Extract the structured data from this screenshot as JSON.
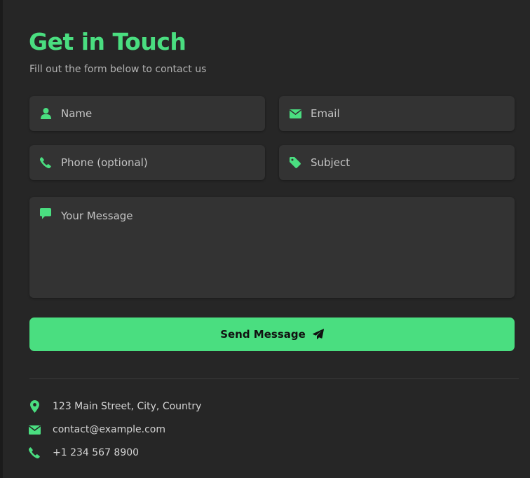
{
  "header": {
    "title": "Get in Touch",
    "subtitle": "Fill out the form below to contact us"
  },
  "form": {
    "name": {
      "placeholder": "Name",
      "value": "",
      "icon": "user-icon"
    },
    "email": {
      "placeholder": "Email",
      "value": "",
      "icon": "envelope-icon"
    },
    "phone": {
      "placeholder": "Phone (optional)",
      "value": "",
      "icon": "phone-icon"
    },
    "subject": {
      "placeholder": "Subject",
      "value": "",
      "icon": "tag-icon"
    },
    "message": {
      "placeholder": "Your Message",
      "value": "",
      "icon": "comment-icon"
    },
    "submit_label": "Send Message",
    "submit_icon": "paper-plane-icon"
  },
  "contact_info": {
    "address": "123 Main Street, City, Country",
    "email": "contact@example.com",
    "phone": "+1 234 567 8900"
  },
  "colors": {
    "accent": "#4ade80",
    "background": "#262626",
    "field_background": "#333333",
    "button_text": "#111111"
  }
}
